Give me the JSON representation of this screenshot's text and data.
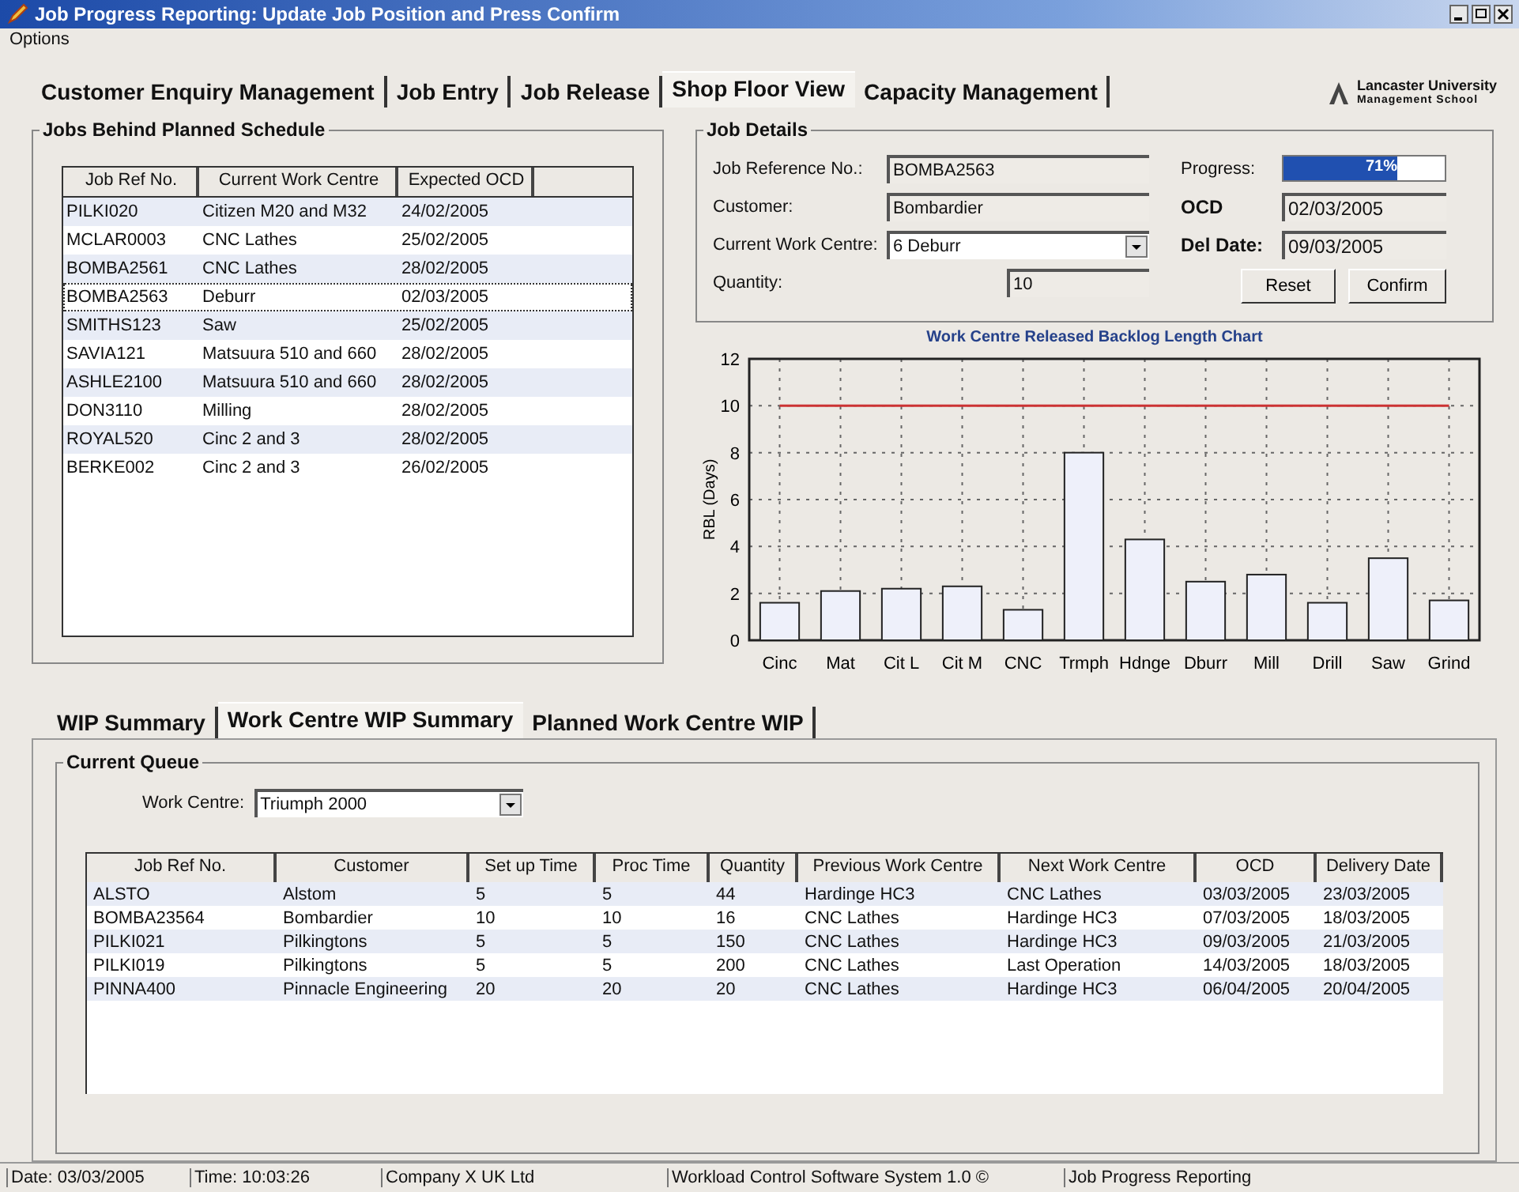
{
  "window": {
    "title": "Job Progress Reporting: Update Job Position and Press Confirm"
  },
  "menu": [
    "Options"
  ],
  "tabs": [
    {
      "label": "Customer Enquiry Management",
      "selected": false
    },
    {
      "label": "Job Entry",
      "selected": false
    },
    {
      "label": "Job Release",
      "selected": false
    },
    {
      "label": "Shop Floor View",
      "selected": true
    },
    {
      "label": "Capacity Management",
      "selected": false
    }
  ],
  "logo": {
    "line_1": "Lancaster University",
    "line_2": "Management School"
  },
  "jobs_behind": {
    "title": "Jobs Behind Planned Schedule",
    "columns": [
      "Job Ref No.",
      "Current Work Centre",
      "Expected OCD"
    ],
    "rows": [
      {
        "cells": [
          "PILKI020",
          "Citizen M20 and M32",
          "24/02/2005"
        ],
        "selected": false
      },
      {
        "cells": [
          "MCLAR0003",
          "CNC Lathes",
          "25/02/2005"
        ],
        "selected": false
      },
      {
        "cells": [
          "BOMBA2561",
          "CNC Lathes",
          "28/02/2005"
        ],
        "selected": false
      },
      {
        "cells": [
          "BOMBA2563",
          "Deburr",
          "02/03/2005"
        ],
        "selected": true
      },
      {
        "cells": [
          "SMITHS123",
          "Saw",
          "25/02/2005"
        ],
        "selected": false
      },
      {
        "cells": [
          "SAVIA121",
          "Matsuura 510 and 660",
          "28/02/2005"
        ],
        "selected": false
      },
      {
        "cells": [
          "ASHLE2100",
          "Matsuura 510 and 660",
          "28/02/2005"
        ],
        "selected": false
      },
      {
        "cells": [
          "DON3110",
          "Milling",
          "28/02/2005"
        ],
        "selected": false
      },
      {
        "cells": [
          "ROYAL520",
          "Cinc 2 and 3",
          "28/02/2005"
        ],
        "selected": false
      },
      {
        "cells": [
          "BERKE002",
          "Cinc 2 and 3",
          "26/02/2005"
        ],
        "selected": false
      }
    ]
  },
  "job_details": {
    "title": "Job Details",
    "job_ref": {
      "label": "Job Reference No.:",
      "value": "BOMBA2563"
    },
    "customer": {
      "label": "Customer:",
      "value": "Bombardier"
    },
    "work_centre": {
      "label": "Current Work Centre:",
      "value": "6 Deburr"
    },
    "quantity": {
      "label": "Quantity:",
      "value": "10"
    },
    "progress": {
      "label": "Progress:",
      "level": 0.71,
      "reading": "71%"
    },
    "ocd": {
      "label": "OCD",
      "value": "02/03/2005"
    },
    "del_date": {
      "label": "Del Date:",
      "value": "09/03/2005"
    },
    "buttons": [
      "Reset",
      "Confirm"
    ]
  },
  "chart": {
    "chart_data": {
      "type": "bar",
      "title": "Work Centre Released Backlog Length Chart",
      "ylabel": "RBL (Days)",
      "categories": [
        "Cinc",
        "Mat",
        "Cit L",
        "Cit M",
        "CNC",
        "Trmph",
        "Hdnge",
        "Dburr",
        "Mill",
        "Drill",
        "Saw",
        "Grind"
      ],
      "series": [
        {
          "color": "#eef0fa",
          "values": [
            1.6,
            2.1,
            2.2,
            2.3,
            1.3,
            8.0,
            4.3,
            2.5,
            2.8,
            1.6,
            3.5,
            1.7
          ]
        }
      ],
      "ylim": [
        0,
        12
      ],
      "yticks": [
        0,
        2,
        4,
        6,
        8,
        10,
        12
      ],
      "grid": true,
      "ref_lines": [
        {
          "axis": "y",
          "value": 10,
          "color": "#cc3333"
        }
      ]
    }
  },
  "bottom_tabs": [
    {
      "label": "WIP Summary",
      "selected": false
    },
    {
      "label": "Work Centre WIP Summary",
      "selected": true
    },
    {
      "label": "Planned Work Centre WIP",
      "selected": false
    }
  ],
  "current_queue": {
    "title": "Current Queue",
    "work_centre": {
      "label": "Work Centre:",
      "value": "Triumph 2000"
    },
    "columns": [
      "Job Ref No.",
      "Customer",
      "Set up Time",
      "Proc Time",
      "Quantity",
      "Previous Work Centre",
      "Next Work Centre",
      "OCD",
      "Delivery Date"
    ],
    "rows": [
      [
        "ALSTO",
        "Alstom",
        "5",
        "5",
        "44",
        "Hardinge HC3",
        "CNC Lathes",
        "03/03/2005",
        "23/03/2005"
      ],
      [
        "BOMBA23564",
        "Bombardier",
        "10",
        "10",
        "16",
        "CNC Lathes",
        "Hardinge HC3",
        "07/03/2005",
        "18/03/2005"
      ],
      [
        "PILKI021",
        "Pilkingtons",
        "5",
        "5",
        "150",
        "CNC Lathes",
        "Hardinge HC3",
        "09/03/2005",
        "21/03/2005"
      ],
      [
        "PILKI019",
        "Pilkingtons",
        "5",
        "5",
        "200",
        "CNC Lathes",
        "Last Operation",
        "14/03/2005",
        "18/03/2005"
      ],
      [
        "PINNA400",
        "Pinnacle Engineering",
        "20",
        "20",
        "20",
        "CNC Lathes",
        "Hardinge HC3",
        "06/04/2005",
        "20/04/2005"
      ]
    ]
  },
  "status_bar": [
    "Date: 03/03/2005",
    "Time: 10:03:26",
    "Company X UK Ltd",
    "Workload Control Software System 1.0 ©",
    "Job Progress Reporting"
  ]
}
